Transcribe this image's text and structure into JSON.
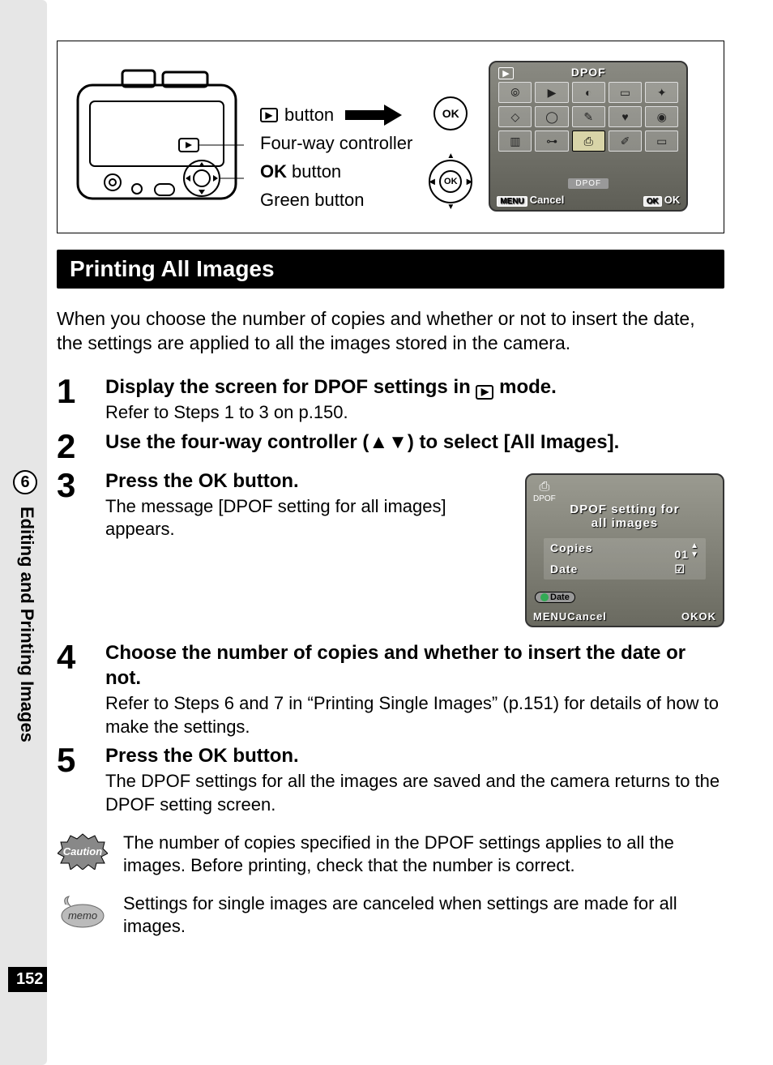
{
  "side": {
    "section_number": "6",
    "section_title": "Editing and Printing Images",
    "page_number": "152"
  },
  "diagram": {
    "labels": {
      "play_button": "button",
      "four_way": "Four-way controller",
      "ok_word": "OK",
      "ok_button": "button",
      "green_button": "Green button"
    },
    "lcd1": {
      "title": "DPOF",
      "caption": "DPOF",
      "menu_label": "MENU",
      "cancel": "Cancel",
      "ok_badge": "OK",
      "ok_text": "OK"
    }
  },
  "heading": "Printing All Images",
  "intro": "When you choose the number of copies and whether or not to insert the date, the settings are applied to all the images stored in the camera.",
  "steps": [
    {
      "num": "1",
      "title_pre": "Display the screen for DPOF settings in ",
      "title_post": " mode.",
      "desc": "Refer to Steps 1 to 3 on p.150."
    },
    {
      "num": "2",
      "title": "Use the four-way controller (▲▼) to select [All Images]."
    },
    {
      "num": "3",
      "title_pre": "Press the ",
      "title_ok": "OK",
      "title_post": " button.",
      "desc": "The message [DPOF setting for all images] appears."
    },
    {
      "num": "4",
      "title": "Choose the number of copies and whether to insert the date or not.",
      "desc": "Refer to Steps 6 and 7 in “Printing Single Images” (p.151) for details of how to make the settings."
    },
    {
      "num": "5",
      "title_pre": "Press the ",
      "title_ok": "OK",
      "title_post": " button.",
      "desc": "The DPOF settings for all the images are saved and the camera returns to the DPOF setting screen."
    }
  ],
  "lcd2": {
    "tag_caption": "DPOF",
    "msg_line1": "DPOF setting for",
    "msg_line2": "all images",
    "copies_label": "Copies",
    "copies_value": "01",
    "date_label": "Date",
    "date_check": "☑",
    "date_pill": "Date",
    "menu_label": "MENU",
    "cancel": "Cancel",
    "ok_badge": "OK",
    "ok_text": "OK"
  },
  "caution": {
    "label": "Caution",
    "text": "The number of copies specified in the DPOF settings applies to all the images. Before printing, check that the number is correct."
  },
  "memo": {
    "label": "memo",
    "text": "Settings for single images are canceled when settings are made for all images."
  }
}
